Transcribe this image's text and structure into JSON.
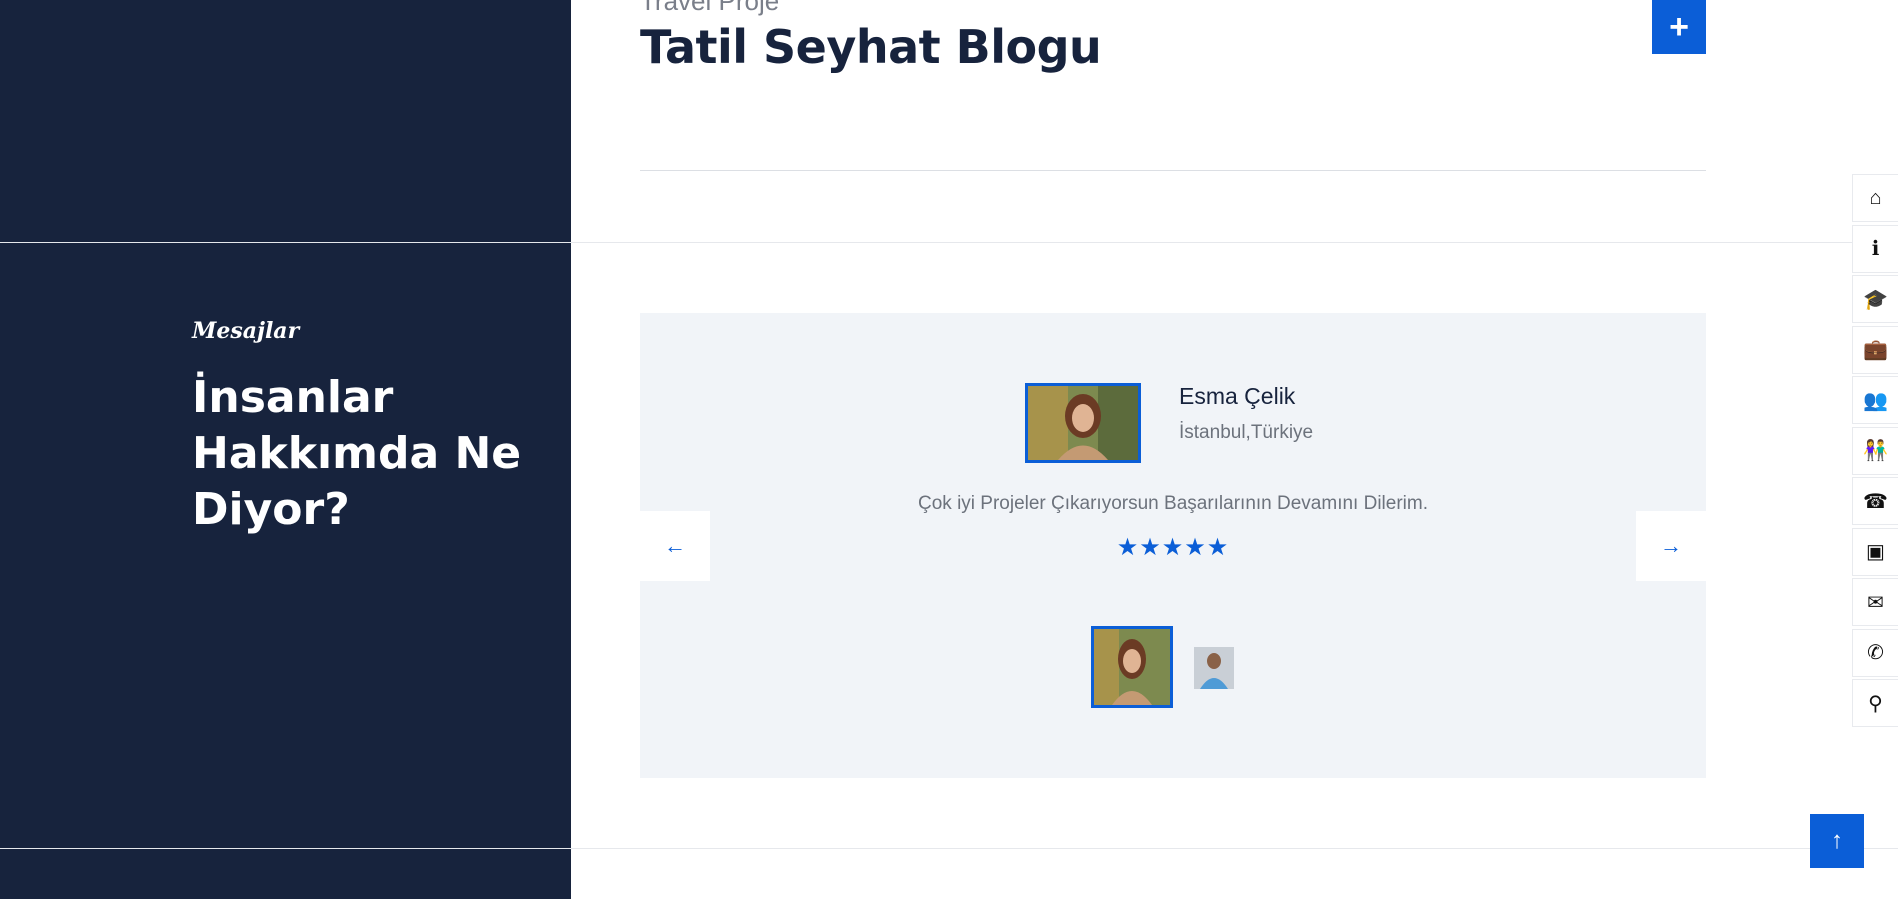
{
  "project": {
    "kicker": "Travel Proje",
    "title": "Tatil Seyhat Blogu",
    "add_label": "+"
  },
  "section": {
    "kicker": "Mesajlar",
    "heading": "İnsanlar Hakkımda Ne Diyor?"
  },
  "testimonial": {
    "name": "Esma Çelik",
    "location": "İstanbul,Türkiye",
    "quote": "Çok iyi Projeler Çıkarıyorsun Başarılarının Devamını Dilerim.",
    "stars": "★★★★★",
    "rating": 5,
    "prev_label": "←",
    "next_label": "→"
  },
  "sidebar": {
    "icons": [
      {
        "name": "home-icon",
        "glyph": "⌂"
      },
      {
        "name": "info-icon",
        "glyph": "ℹ"
      },
      {
        "name": "graduation-cap-icon",
        "glyph": "🎓"
      },
      {
        "name": "briefcase-icon",
        "glyph": "💼"
      },
      {
        "name": "users-icon",
        "glyph": "👥"
      },
      {
        "name": "people-icon",
        "glyph": "👫"
      },
      {
        "name": "support-icon",
        "glyph": "☎"
      },
      {
        "name": "post-icon",
        "glyph": "▣"
      },
      {
        "name": "envelope-icon",
        "glyph": "✉"
      },
      {
        "name": "phone-icon",
        "glyph": "✆"
      },
      {
        "name": "location-pin-icon",
        "glyph": "⚲"
      }
    ]
  },
  "scroll_top_label": "↑",
  "colors": {
    "navy": "#17233d",
    "accent": "#0b5ed7",
    "card": "#f1f4f8"
  }
}
